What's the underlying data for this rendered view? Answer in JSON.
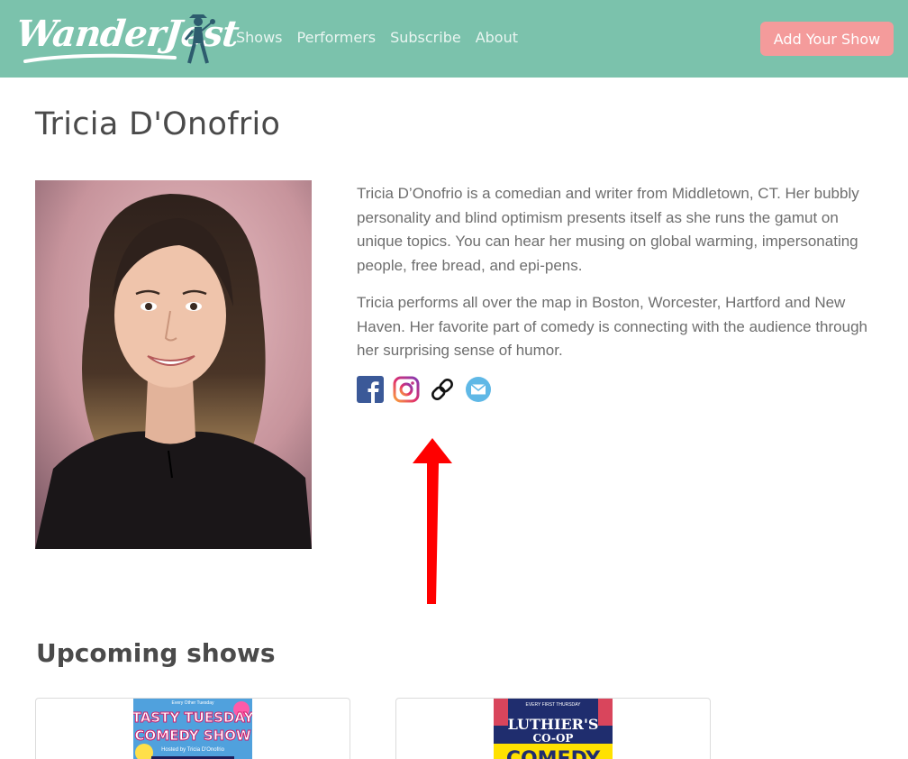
{
  "brand": {
    "name": "WanderJest"
  },
  "nav": {
    "links": [
      "Shows",
      "Performers",
      "Subscribe",
      "About"
    ],
    "cta": "Add Your Show"
  },
  "performer": {
    "name": "Tricia D'Onofrio",
    "bio": [
      "Tricia D’Onofrio is a comedian and writer from Middletown, CT. Her bubbly personality and blind optimism presents itself as she runs the gamut on unique topics. You can hear her musing on global warming, impersonating people, free bread, and epi-pens.",
      "Tricia performs all over the map in Boston, Worcester, Hartford and New Haven. Her favorite part of comedy is connecting with the audience through her surprising sense of humor."
    ],
    "social_icons": [
      "facebook-icon",
      "instagram-icon",
      "link-icon",
      "email-icon"
    ]
  },
  "upcoming": {
    "title": "Upcoming shows",
    "shows": [
      {
        "poster_lines": [
          "TASTY TUESDAY",
          "COMEDY SHOW"
        ],
        "poster_top": "Every Other Tuesday",
        "poster_sub": "Hosted by Tricia D'Onofrio"
      },
      {
        "poster_lines": [
          "LUTHIER'S",
          "CO-OP",
          "COMEDY"
        ],
        "poster_top": "EVERY FIRST THURSDAY"
      }
    ]
  },
  "colors": {
    "navbar": "#7bc2ac",
    "cta": "#f49b9b",
    "annotation_arrow": "#ff0000"
  }
}
